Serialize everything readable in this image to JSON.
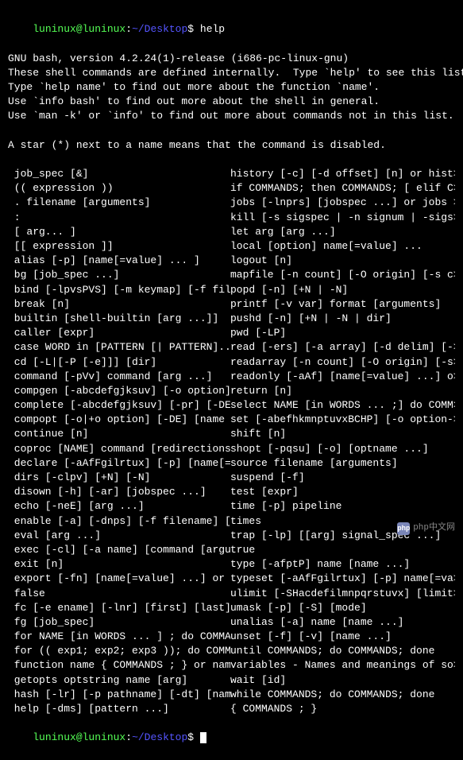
{
  "prompt1": {
    "user": "luninux@luninux",
    "sep": ":",
    "path": "~/Desktop",
    "symbol": "$",
    "command": "help"
  },
  "header": [
    "GNU bash, version 4.2.24(1)-release (i686-pc-linux-gnu)",
    "These shell commands are defined internally.  Type `help' to see this list.",
    "Type `help name' to find out more about the function `name'.",
    "Use `info bash' to find out more about the shell in general.",
    "Use `man -k' or `info' to find out more about commands not in this list.",
    "",
    "A star (*) next to a name means that the command is disabled.",
    ""
  ],
  "left_col": [
    " job_spec [&]",
    " (( expression ))",
    " . filename [arguments]",
    " :",
    " [ arg... ]",
    " [[ expression ]]",
    " alias [-p] [name[=value] ... ]",
    " bg [job_spec ...]",
    " bind [-lpvsPVS] [-m keymap] [-f filen>",
    " break [n]",
    " builtin [shell-builtin [arg ...]]",
    " caller [expr]",
    " case WORD in [PATTERN [| PATTERN]...)>",
    " cd [-L|[-P [-e]]] [dir]",
    " command [-pVv] command [arg ...]",
    " compgen [-abcdefgjksuv] [-o option]  >",
    " complete [-abcdefgjksuv] [-pr] [-DE] >",
    " compopt [-o|+o option] [-DE] [name ..>",
    " continue [n]",
    " coproc [NAME] command [redirections]",
    " declare [-aAfFgilrtux] [-p] [name[=va>",
    " dirs [-clpv] [+N] [-N]",
    " disown [-h] [-ar] [jobspec ...]",
    " echo [-neE] [arg ...]",
    " enable [-a] [-dnps] [-f filename] [na>",
    " eval [arg ...]",
    " exec [-cl] [-a name] [command [argume>",
    " exit [n]",
    " export [-fn] [name[=value] ...] or ex>",
    " false",
    " fc [-e ename] [-lnr] [first] [last] o>",
    " fg [job_spec]",
    " for NAME [in WORDS ... ] ; do COMMAND>",
    " for (( exp1; exp2; exp3 )); do COMMAN>",
    " function name { COMMANDS ; } or name >",
    " getopts optstring name [arg]",
    " hash [-lr] [-p pathname] [-dt] [name >",
    " help [-dms] [pattern ...]"
  ],
  "right_col": [
    "history [-c] [-d offset] [n] or hist>",
    "if COMMANDS; then COMMANDS; [ elif C>",
    "jobs [-lnprs] [jobspec ...] or jobs >",
    "kill [-s sigspec | -n signum | -sigs>",
    "let arg [arg ...]",
    "local [option] name[=value] ...",
    "logout [n]",
    "mapfile [-n count] [-O origin] [-s c>",
    "popd [-n] [+N | -N]",
    "printf [-v var] format [arguments]",
    "pushd [-n] [+N | -N | dir]",
    "pwd [-LP]",
    "read [-ers] [-a array] [-d delim] [->",
    "readarray [-n count] [-O origin] [-s>",
    "readonly [-aAf] [name[=value] ...] o>",
    "return [n]",
    "select NAME [in WORDS ... ;] do COMM>",
    "set [-abefhkmnptuvxBCHP] [-o option->",
    "shift [n]",
    "shopt [-pqsu] [-o] [optname ...]",
    "source filename [arguments]",
    "suspend [-f]",
    "test [expr]",
    "time [-p] pipeline",
    "times",
    "trap [-lp] [[arg] signal_spec ...]",
    "true",
    "type [-afptP] name [name ...]",
    "typeset [-aAfFgilrtux] [-p] name[=va>",
    "ulimit [-SHacdefilmnpqrstuvx] [limit>",
    "umask [-p] [-S] [mode]",
    "unalias [-a] name [name ...]",
    "unset [-f] [-v] [name ...]",
    "until COMMANDS; do COMMANDS; done",
    "variables - Names and meanings of so>",
    "wait [id]",
    "while COMMANDS; do COMMANDS; done",
    "{ COMMANDS ; }"
  ],
  "prompt2": {
    "user": "luninux@luninux",
    "sep": ":",
    "path": "~/Desktop",
    "symbol": "$"
  },
  "watermark": {
    "icon": "php",
    "text": "php中文网"
  }
}
